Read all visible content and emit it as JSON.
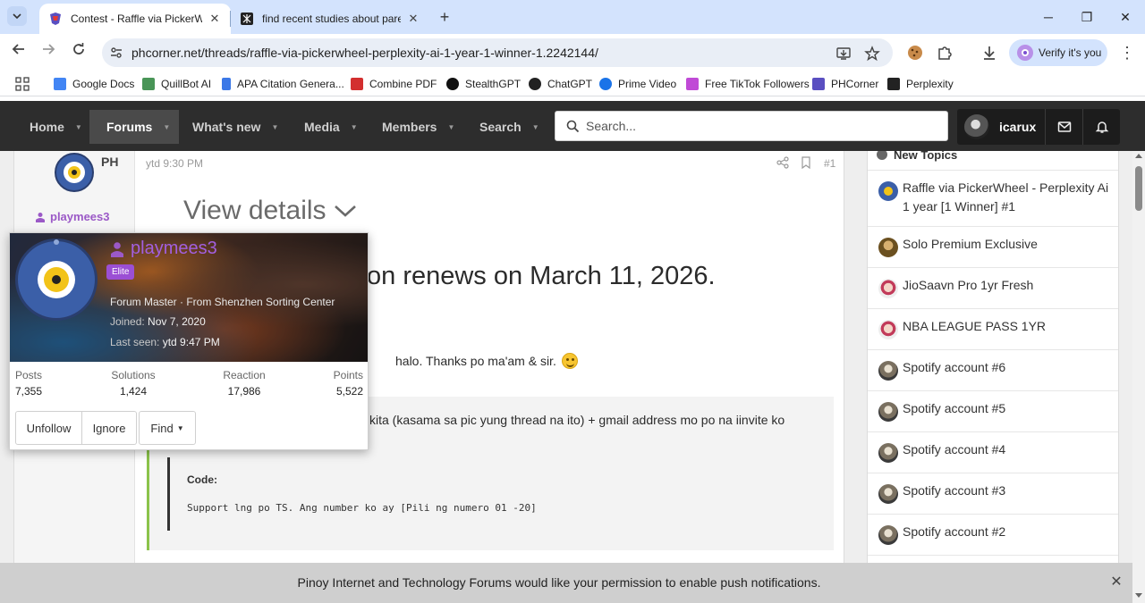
{
  "browser": {
    "tabs": [
      {
        "title": "Contest - Raffle via PickerWhee",
        "active": true
      },
      {
        "title": "find recent studies about paren",
        "active": false
      }
    ],
    "url": "phcorner.net/threads/raffle-via-pickerwheel-perplexity-ai-1-year-1-winner-1.2242144/",
    "verify_label": "Verify it's you",
    "bookmarks": [
      {
        "label": "Google Docs",
        "icon": "google-docs-icon",
        "color": "#4285f4"
      },
      {
        "label": "QuillBot AI",
        "icon": "quillbot-icon",
        "color": "#499557"
      },
      {
        "label": "APA Citation Genera...",
        "icon": "bookmark-icon",
        "color": "#3b78e7"
      },
      {
        "label": "Combine PDF",
        "icon": "pdf-icon",
        "color": "#d32f2f"
      },
      {
        "label": "StealthGPT",
        "icon": "stealthgpt-icon",
        "color": "#111111"
      },
      {
        "label": "ChatGPT",
        "icon": "chatgpt-icon",
        "color": "#222222"
      },
      {
        "label": "Prime Video",
        "icon": "prime-video-icon",
        "color": "#1a73e8"
      },
      {
        "label": "Free TikTok Followers",
        "icon": "tiktok-icon",
        "color": "#c04ad6"
      },
      {
        "label": "PHCorner",
        "icon": "phcorner-icon",
        "color": "#5a4fc1"
      },
      {
        "label": "Perplexity",
        "icon": "perplexity-icon",
        "color": "#222222"
      }
    ]
  },
  "site_nav": {
    "items": [
      {
        "label": "Home"
      },
      {
        "label": "Forums"
      },
      {
        "label": "What's new"
      },
      {
        "label": "Media"
      },
      {
        "label": "Members"
      },
      {
        "label": "Search"
      }
    ],
    "search_placeholder": "Search...",
    "username": "icarux"
  },
  "post": {
    "author_label": "PH",
    "username": "playmees3",
    "time": "ytd 9:30 PM",
    "number": "#1",
    "view_details": "View details",
    "renews_text": "on renews on March 11, 2026.",
    "thanks_text": "halo. Thanks po ma'am & sir.",
    "quote_text": "kita (kasama sa pic yung thread na ito) + gmail address mo po na iinvite ko",
    "code_label": "Code:",
    "code_text": "Support lng po TS. Ang number ko ay [Pili ng numero 01 -20]"
  },
  "sidebar": {
    "heading": "New Topics",
    "topics": [
      {
        "title": "Raffle via PickerWheel - Perplexity Ai 1 year [1 Winner] #1"
      },
      {
        "title": "Solo Premium Exclusive"
      },
      {
        "title": "JioSaavn Pro 1yr Fresh"
      },
      {
        "title": "NBA LEAGUE PASS 1YR"
      },
      {
        "title": "Spotify account #6"
      },
      {
        "title": "Spotify account #5"
      },
      {
        "title": "Spotify account #4"
      },
      {
        "title": "Spotify account #3"
      },
      {
        "title": "Spotify account #2"
      }
    ]
  },
  "member_card": {
    "username": "playmees3",
    "badge": "Elite",
    "title_line": "Forum Master · From Shenzhen Sorting Center",
    "joined_label": "Joined:",
    "joined_value": "Nov 7, 2020",
    "last_seen_label": "Last seen:",
    "last_seen_value": "ytd 9:47 PM",
    "stats": [
      {
        "label": "Posts",
        "value": "7,355"
      },
      {
        "label": "Solutions",
        "value": "1,424"
      },
      {
        "label": "Reaction",
        "value": "17,986"
      },
      {
        "label": "Points",
        "value": "5,522"
      }
    ],
    "buttons": {
      "unfollow": "Unfollow",
      "ignore": "Ignore",
      "find": "Find"
    }
  },
  "notification": {
    "text": "Pinoy Internet and Technology Forums would like your permission to enable push notifications."
  }
}
